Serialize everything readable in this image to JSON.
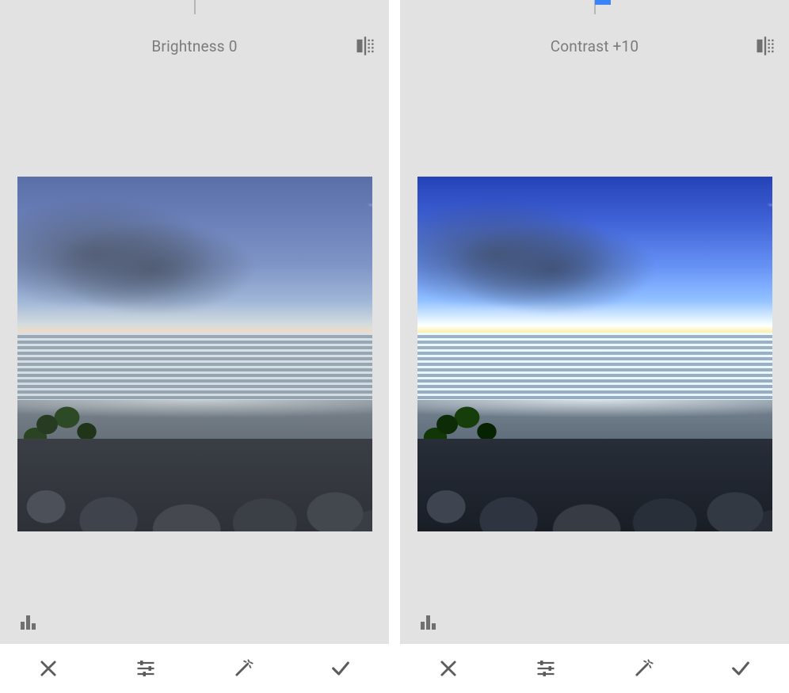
{
  "panels": [
    {
      "id": "brightness",
      "label": "Brightness 0",
      "param": "Brightness",
      "value": 0,
      "marker_offset_pct": 50,
      "marker_width_px": 0
    },
    {
      "id": "contrast",
      "label": "Contrast +10",
      "param": "Contrast",
      "value": 10,
      "marker_offset_pct": 50,
      "marker_width_px": 20
    }
  ],
  "icons": {
    "compare": "compare-icon",
    "histogram": "histogram-icon",
    "cancel": "close-icon",
    "adjust": "sliders-icon",
    "auto": "magic-wand-icon",
    "apply": "check-icon"
  },
  "colors": {
    "accent": "#3a82f7",
    "panel_bg": "#e2e2e2",
    "toolbar_bg": "#ffffff",
    "icon": "#707070"
  }
}
